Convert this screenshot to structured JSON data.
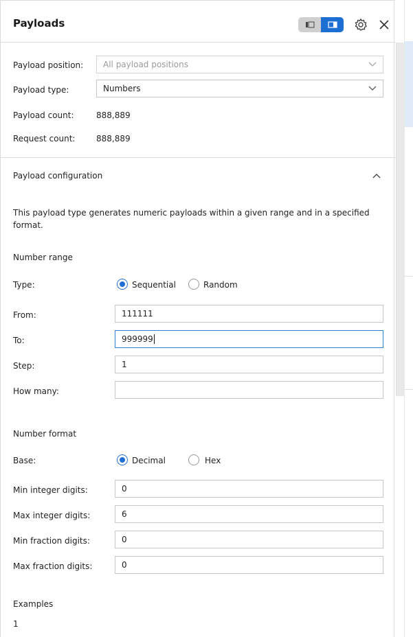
{
  "header": {
    "title": "Payloads"
  },
  "position": {
    "label": "Payload position:",
    "placeholder": "All payload positions"
  },
  "type": {
    "label": "Payload type:",
    "value": "Numbers"
  },
  "counts": {
    "payload_label": "Payload count:",
    "payload_value": "888,889",
    "request_label": "Request count:",
    "request_value": "888,889"
  },
  "config": {
    "section_title": "Payload configuration",
    "description": "This payload type generates numeric payloads within a given range and in a specified format.",
    "range_title": "Number range",
    "type_label": "Type:",
    "sequential_label": "Sequential",
    "random_label": "Random",
    "from_label": "From:",
    "from_value": "111111",
    "to_label": "To:",
    "to_value": "999999",
    "step_label": "Step:",
    "step_value": "1",
    "howmany_label": "How many:",
    "howmany_value": "",
    "format_title": "Number format",
    "base_label": "Base:",
    "decimal_label": "Decimal",
    "hex_label": "Hex",
    "min_int_label": "Min integer digits:",
    "min_int_value": "0",
    "max_int_label": "Max integer digits:",
    "max_int_value": "6",
    "min_frac_label": "Min fraction digits:",
    "min_frac_value": "0",
    "max_frac_label": "Max fraction digits:",
    "max_frac_value": "0",
    "examples_title": "Examples",
    "example_1": "1"
  },
  "colors": {
    "accent": "#1e6fd4",
    "toggle_off": "#cfcfcf",
    "border": "#c6c6c6"
  },
  "icons": {
    "layout_left": "panel-left-icon",
    "layout_right": "panel-right-icon",
    "settings": "gear-icon",
    "close": "close-icon"
  }
}
